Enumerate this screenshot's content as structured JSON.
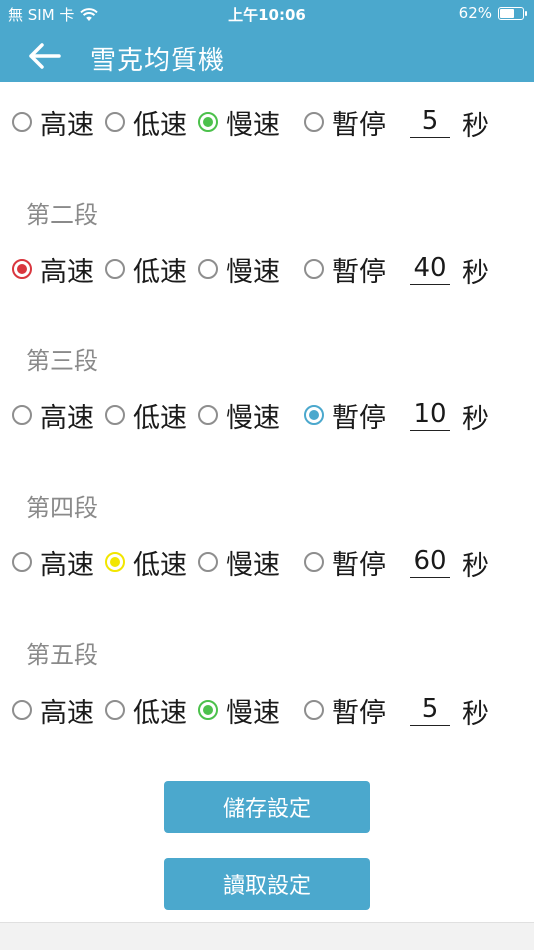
{
  "status": {
    "carrier": "無 SIM 卡",
    "time": "上午10:06",
    "battery": "62%",
    "battery_level": 0.62
  },
  "header": {
    "title": "雪克均質機"
  },
  "option_labels": [
    "高速",
    "低速",
    "慢速",
    "暫停"
  ],
  "unit": "秒",
  "colors": {
    "header": "#4ba8cd",
    "high": "#d9363e",
    "low": "#f2e600",
    "slow": "#4cc14c",
    "pause": "#4ba8cd"
  },
  "segments": [
    {
      "title": "",
      "selected": 2,
      "seconds": "5"
    },
    {
      "title": "第二段",
      "selected": 0,
      "seconds": "40"
    },
    {
      "title": "第三段",
      "selected": 3,
      "seconds": "10"
    },
    {
      "title": "第四段",
      "selected": 1,
      "seconds": "60"
    },
    {
      "title": "第五段",
      "selected": 2,
      "seconds": "5"
    }
  ],
  "buttons": {
    "save": "儲存設定",
    "load": "讀取設定"
  }
}
